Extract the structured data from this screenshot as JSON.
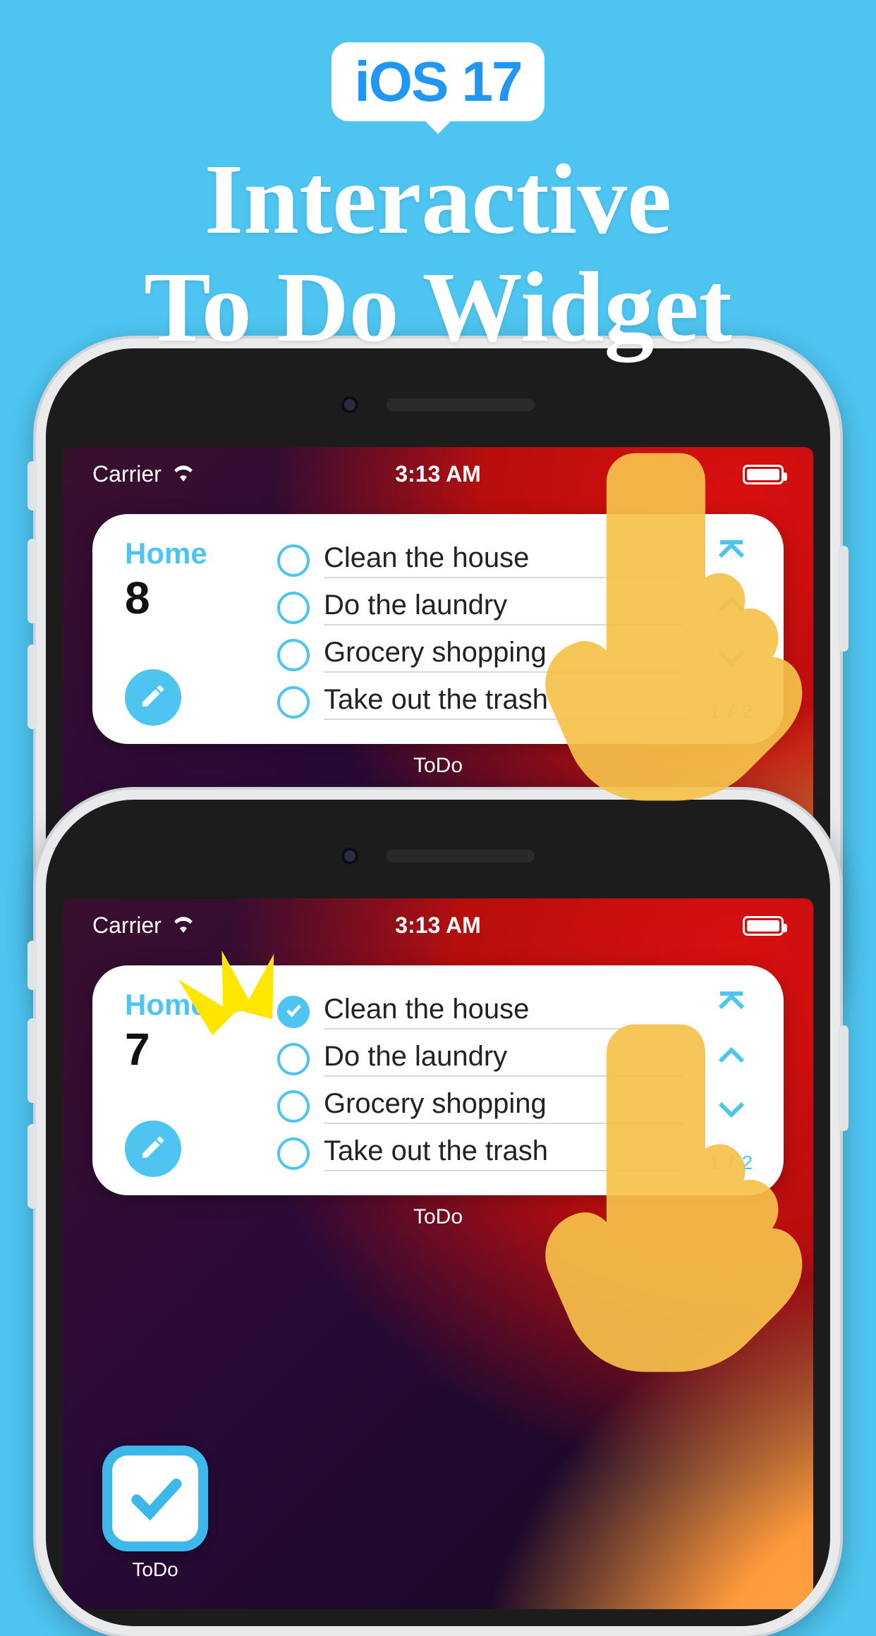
{
  "hero": {
    "badge": "iOS 17",
    "headline_line1": "Interactive",
    "headline_line2": "To Do Widget"
  },
  "status": {
    "carrier": "Carrier",
    "time": "3:13 AM"
  },
  "widget": {
    "list_name": "Home",
    "page_indicator": "1 / 2",
    "under_label": "ToDo",
    "tasks": [
      "Clean the house",
      "Do the laundry",
      "Grocery shopping",
      "Take out the trash"
    ],
    "count_before": "8",
    "count_after": "7"
  },
  "app": {
    "name": "ToDo"
  }
}
